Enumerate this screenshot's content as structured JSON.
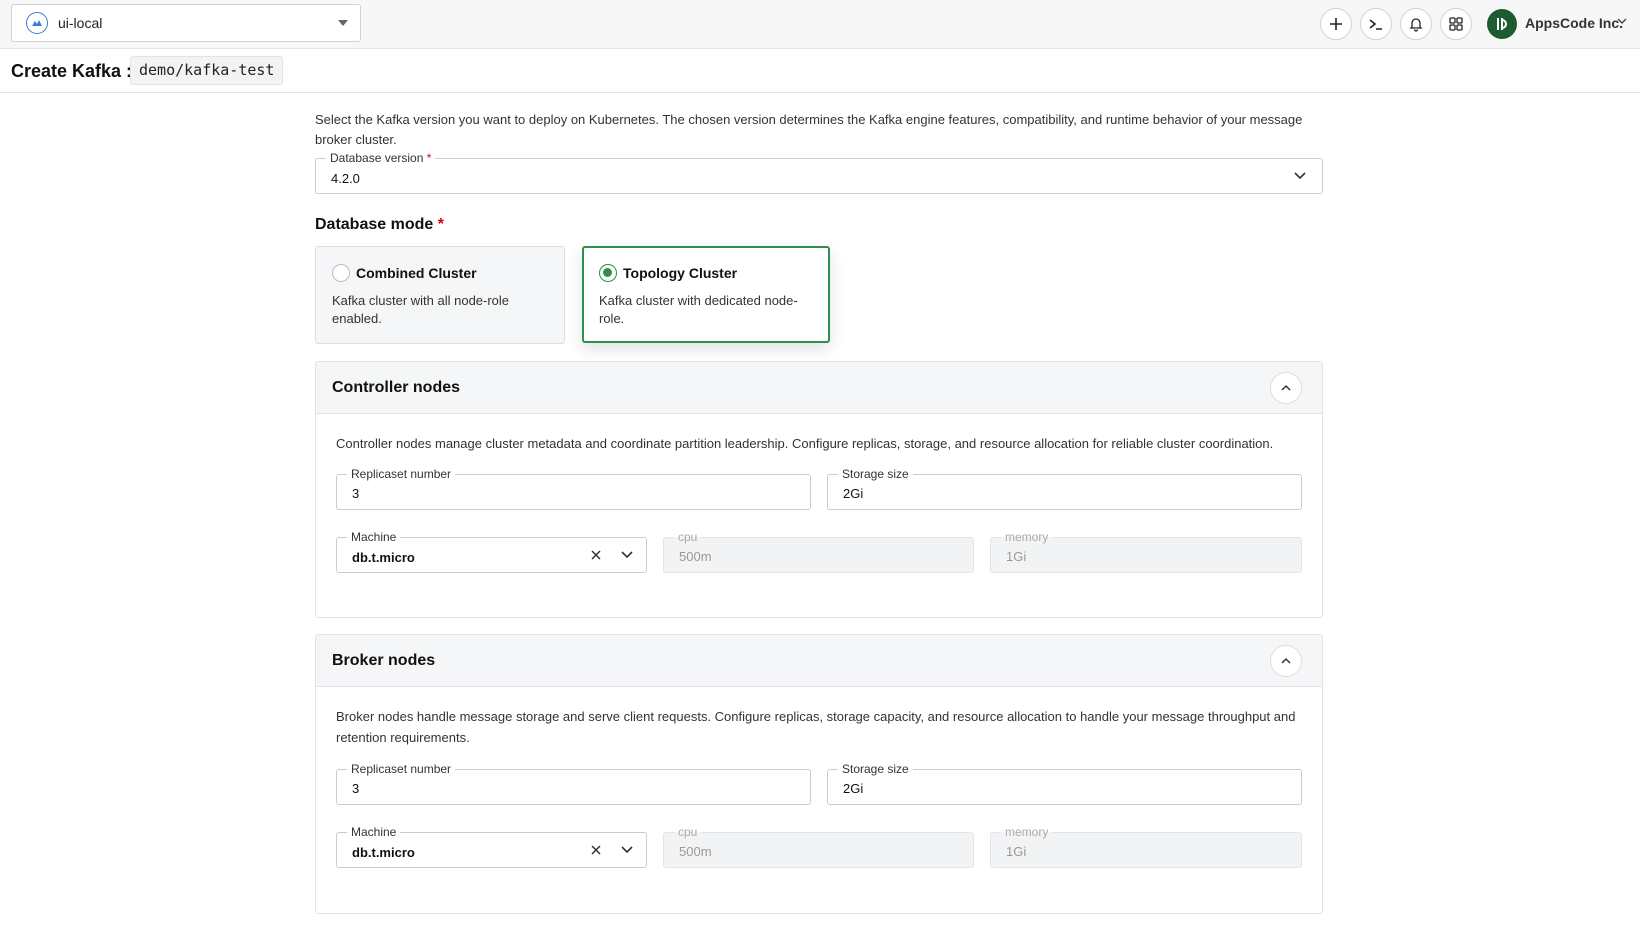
{
  "topbar": {
    "cluster_name": "ui-local",
    "org_name": "AppsCode Inc.",
    "icons": [
      "add-icon",
      "terminal-icon",
      "bell-icon",
      "apps-grid-icon"
    ]
  },
  "header": {
    "title": "Create Kafka :",
    "subtitle": "demo/kafka-test"
  },
  "intro": "Select the Kafka version you want to deploy on Kubernetes. The chosen version determines the Kafka engine features, compatibility, and runtime behavior of your message broker cluster.",
  "version": {
    "label": "Database version",
    "required": "*",
    "value": "4.2.0"
  },
  "mode": {
    "label": "Database mode",
    "required": "*",
    "options": [
      {
        "title": "Combined Cluster",
        "desc": "Kafka cluster with all node-role enabled.",
        "selected": false
      },
      {
        "title": "Topology Cluster",
        "desc": "Kafka cluster with dedicated node-role.",
        "selected": true
      }
    ]
  },
  "controller": {
    "title": "Controller nodes",
    "desc": "Controller nodes manage cluster metadata and coordinate partition leadership. Configure replicas, storage, and resource allocation for reliable cluster coordination.",
    "replicas_label": "Replicaset number",
    "replicas": "3",
    "storage_label": "Storage size",
    "storage": "2Gi",
    "machine_label": "Machine",
    "machine": "db.t.micro",
    "cpu_label": "cpu",
    "cpu": "500m",
    "memory_label": "memory",
    "memory": "1Gi"
  },
  "broker": {
    "title": "Broker nodes",
    "desc": "Broker nodes handle message storage and serve client requests. Configure replicas, storage capacity, and resource allocation to handle your message throughput and retention requirements.",
    "replicas_label": "Replicaset number",
    "replicas": "3",
    "storage_label": "Storage size",
    "storage": "2Gi",
    "machine_label": "Machine",
    "machine": "db.t.micro",
    "cpu_label": "cpu",
    "cpu": "500m",
    "memory_label": "memory",
    "memory": "1Gi"
  },
  "colors": {
    "accent_green": "#2f8d4e",
    "required_red": "#d0021b",
    "border": "#c9ccd1"
  }
}
